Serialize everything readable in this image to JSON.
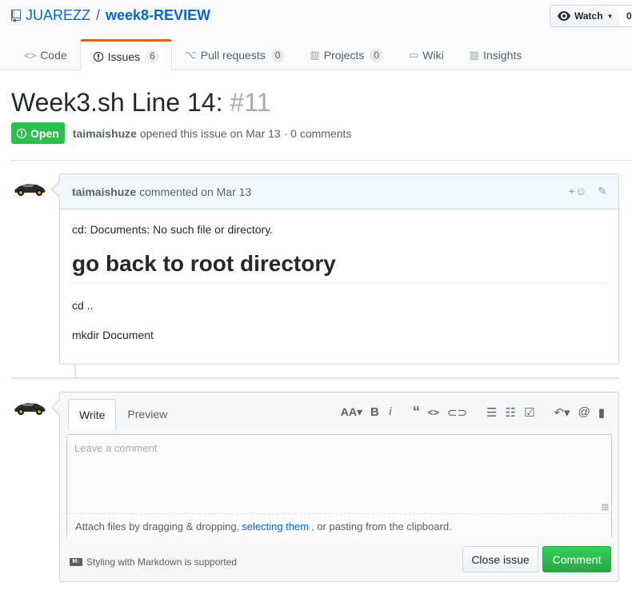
{
  "repo": {
    "owner": "JUAREZZ",
    "separator": "/",
    "name": "week8-REVIEW",
    "watch_label": "Watch",
    "watch_count": "0"
  },
  "nav": {
    "items": [
      {
        "label": "Code",
        "icon": "code-icon",
        "count": ""
      },
      {
        "label": "Issues",
        "icon": "issue-opened-icon",
        "count": "6"
      },
      {
        "label": "Pull requests",
        "icon": "git-pull-request-icon",
        "count": "0"
      },
      {
        "label": "Projects",
        "icon": "project-icon",
        "count": "0"
      },
      {
        "label": "Wiki",
        "icon": "book-icon",
        "count": ""
      },
      {
        "label": "Insights",
        "icon": "graph-icon",
        "count": ""
      }
    ]
  },
  "issue": {
    "title": "Week3.sh Line 14:",
    "number": "#11",
    "state": "Open",
    "author": "taimaishuze",
    "meta": "opened this issue on Mar 13 · 0 comments"
  },
  "comment": {
    "author": "taimaishuze",
    "meta": "commented on Mar 13",
    "line1": "cd: Documents: No such file or directory.",
    "heading": "go back to root directory",
    "line2": "cd ..",
    "line3": "mkdir Document"
  },
  "new_comment": {
    "tab_write": "Write",
    "tab_preview": "Preview",
    "placeholder": "Leave a comment",
    "attach_prefix": "Attach files by dragging & dropping,",
    "attach_link": "selecting them",
    "attach_suffix": ", or pasting from the clipboard.",
    "markdown_hint": "Styling with Markdown is supported",
    "close_label": "Close issue",
    "comment_label": "Comment"
  },
  "colors": {
    "accent": "#0366d6",
    "open_green": "#2cbe4e",
    "selected_tab": "#e36209"
  }
}
